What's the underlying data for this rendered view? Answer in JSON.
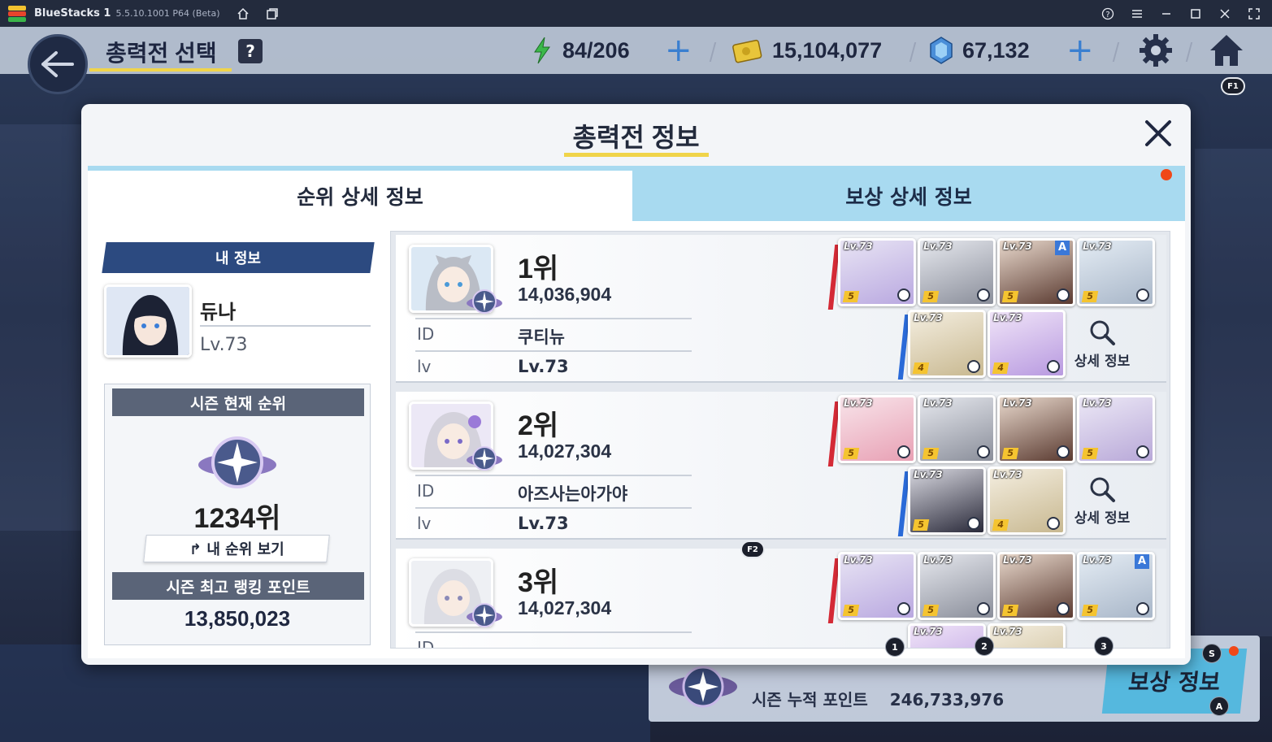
{
  "bluestacks": {
    "app_name": "BlueStacks 1",
    "version": "5.5.10.1001 P64 (Beta)"
  },
  "header": {
    "title": "총력전 선택",
    "help": "?",
    "energy": "84/206",
    "credits": "15,104,077",
    "gems": "67,132",
    "hotkey_home": "F1"
  },
  "background_panel": {
    "season_points_label": "시즌 누적 포인트",
    "season_points_value": "246,733,976",
    "reward_button": "보상 정보",
    "hotkey_s": "S",
    "hotkey_a": "A"
  },
  "modal": {
    "title": "총력전 정보",
    "tabs": [
      {
        "label": "순위 상세 정보",
        "active": true
      },
      {
        "label": "보상 상세 정보",
        "active": false
      }
    ]
  },
  "my_info": {
    "section_label": "내 정보",
    "name": "듀나",
    "level": "Lv.73",
    "season_rank_label": "시즌 현재 순위",
    "rank": "1234위",
    "view_rank_button": "내 순위 보기",
    "best_points_label": "시즌 최고 랭킹 포인트",
    "best_points": "13,850,023"
  },
  "rankings": [
    {
      "rank": "1위",
      "score": "14,036,904",
      "id_label": "ID",
      "id": "쿠티뉴",
      "lv_label": "lv",
      "lv": "Lv.73",
      "detail_button": "상세 정보"
    },
    {
      "rank": "2위",
      "score": "14,027,304",
      "id_label": "ID",
      "id": "아즈사는아가야",
      "lv_label": "lv",
      "lv": "Lv.73",
      "detail_button": "상세 정보"
    },
    {
      "rank": "3위",
      "score": "14,027,304",
      "id_label": "ID",
      "id": "",
      "lv_label": "",
      "lv": "",
      "detail_button": ""
    }
  ],
  "char_level": "Lv.73",
  "grade_badge": "A",
  "hotkeys": {
    "f2": "F2",
    "n1": "1",
    "n2": "2",
    "n3": "3"
  },
  "colors": {
    "accent_yellow": "#f0d44a",
    "tab_blue": "#a8daf0",
    "dark_label": "#5a6478",
    "my_info_bar": "#2c4a80",
    "notification": "#f04818"
  }
}
